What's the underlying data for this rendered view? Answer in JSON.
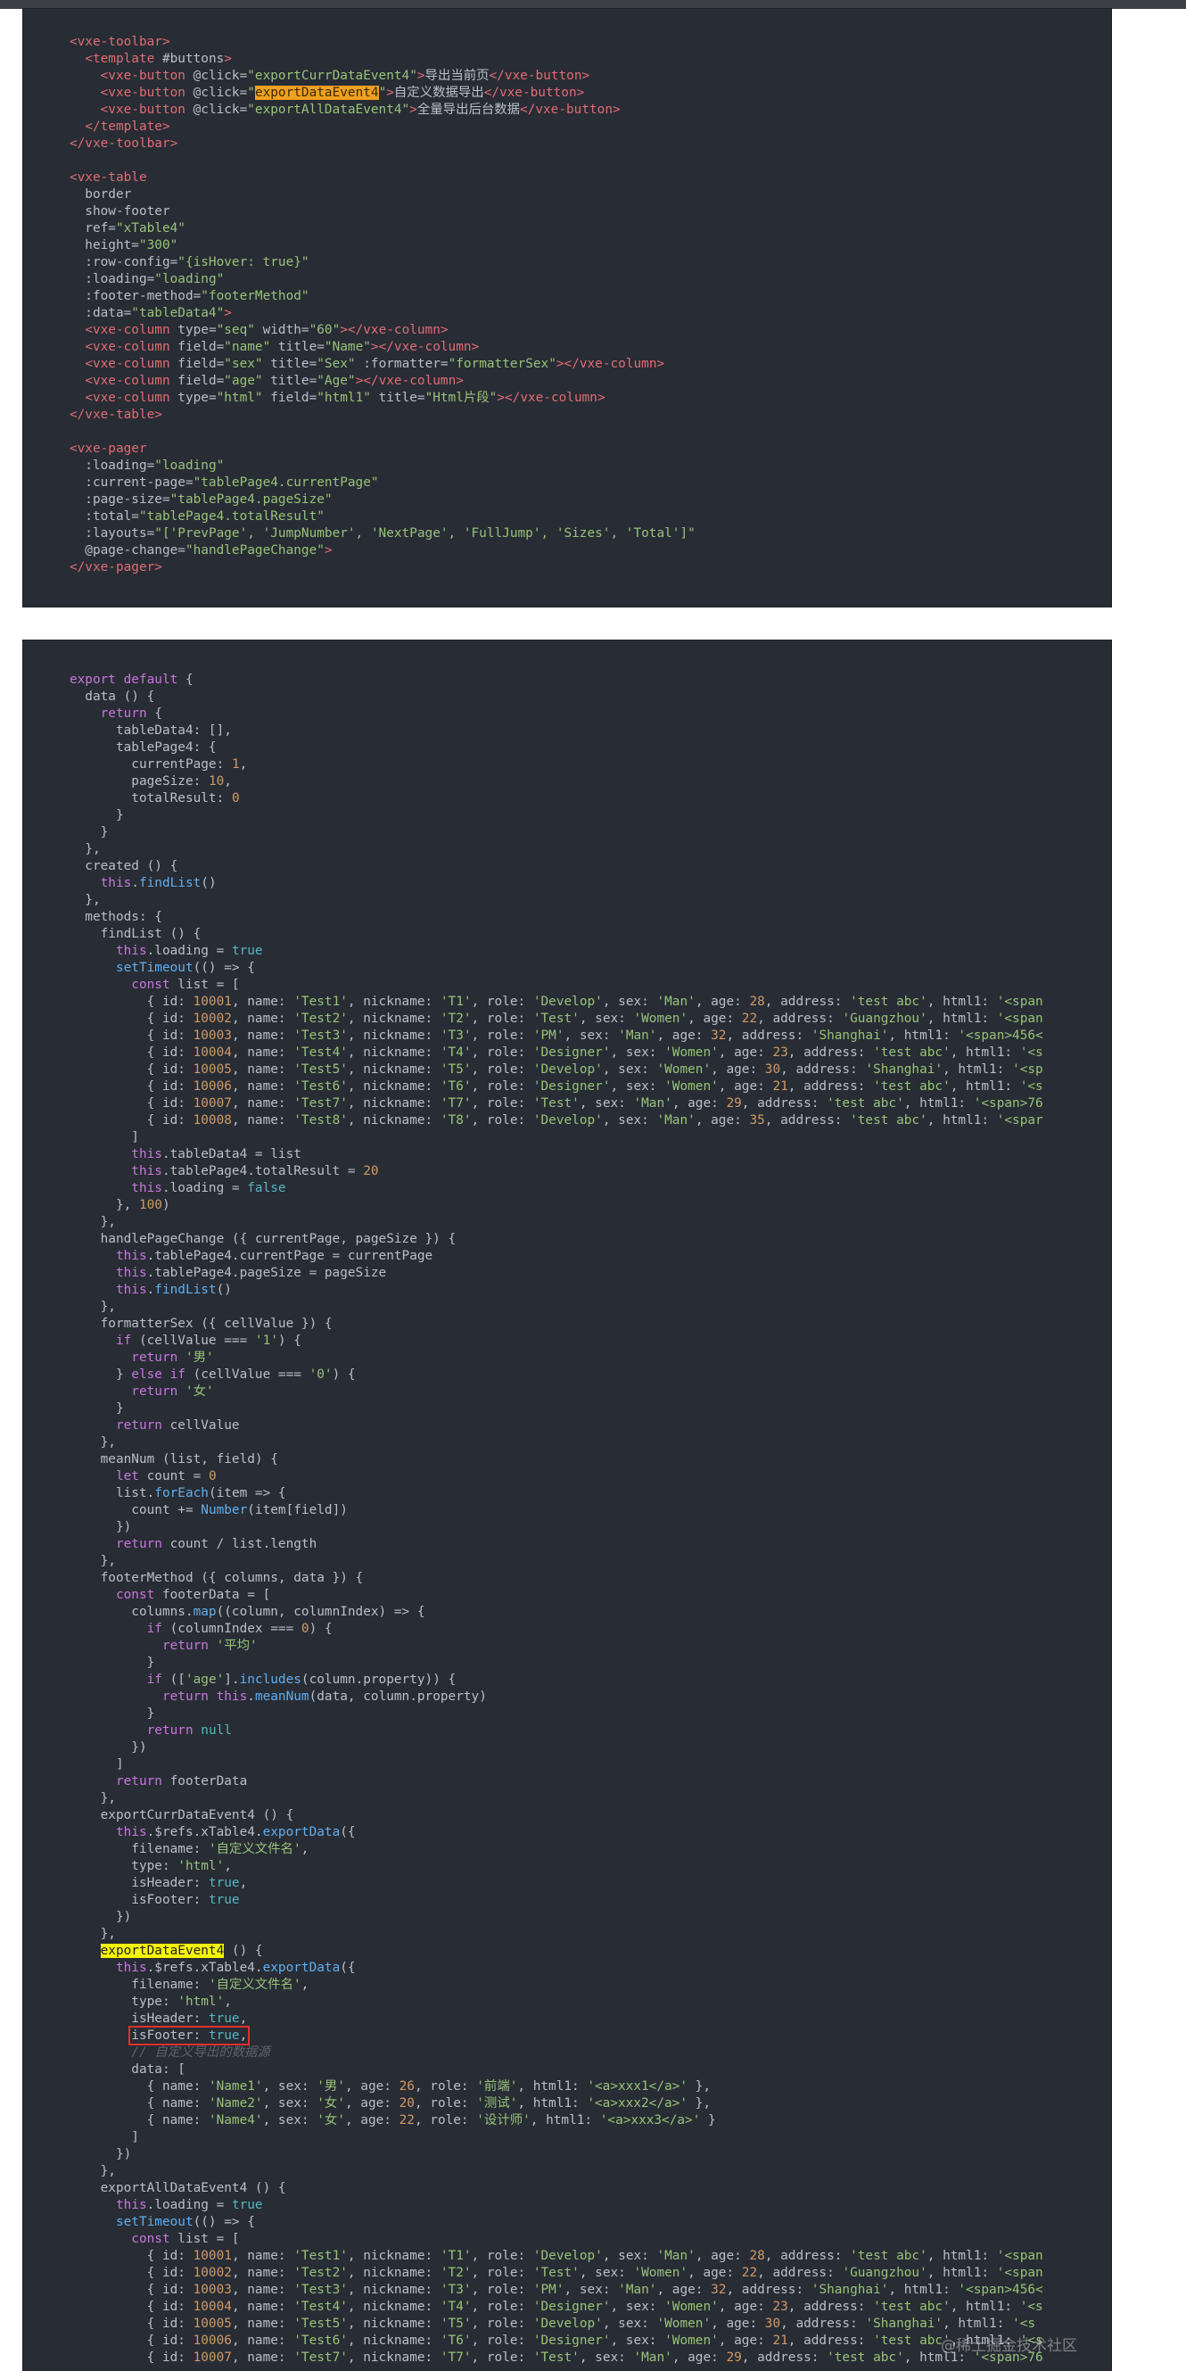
{
  "template_code": [
    "      <vxe-toolbar>",
    "        <template #buttons>",
    "          <vxe-button @click=\"exportCurrDataEvent4\">导出当前页</vxe-button>",
    "          <vxe-button @click=\"exportDataEvent4\">自定义数据导出</vxe-button>",
    "          <vxe-button @click=\"exportAllDataEvent4\">全量导出后台数据</vxe-button>",
    "        </template>",
    "      </vxe-toolbar>",
    "",
    "      <vxe-table",
    "        border",
    "        show-footer",
    "        ref=\"xTable4\"",
    "        height=\"300\"",
    "        :row-config=\"{isHover: true}\"",
    "        :loading=\"loading\"",
    "        :footer-method=\"footerMethod\"",
    "        :data=\"tableData4\">",
    "        <vxe-column type=\"seq\" width=\"60\"></vxe-column>",
    "        <vxe-column field=\"name\" title=\"Name\"></vxe-column>",
    "        <vxe-column field=\"sex\" title=\"Sex\" :formatter=\"formatterSex\"></vxe-column>",
    "        <vxe-column field=\"age\" title=\"Age\"></vxe-column>",
    "        <vxe-column type=\"html\" field=\"html1\" title=\"Html片段\"></vxe-column>",
    "      </vxe-table>",
    "",
    "      <vxe-pager",
    "        :loading=\"loading\"",
    "        :current-page=\"tablePage4.currentPage\"",
    "        :page-size=\"tablePage4.pageSize\"",
    "        :total=\"tablePage4.totalResult\"",
    "        :layouts=\"['PrevPage', 'JumpNumber', 'NextPage', 'FullJump', 'Sizes', 'Total']\"",
    "        @page-change=\"handlePageChange\">",
    "      </vxe-pager>"
  ],
  "script_code": [
    "      export default {",
    "        data () {",
    "          return {",
    "            tableData4: [],",
    "            tablePage4: {",
    "              currentPage: 1,",
    "              pageSize: 10,",
    "              totalResult: 0",
    "            }",
    "          }",
    "        },",
    "        created () {",
    "          this.findList()",
    "        },",
    "        methods: {",
    "          findList () {",
    "            this.loading = true",
    "            setTimeout(() => {",
    "              const list = [",
    "                { id: 10001, name: 'Test1', nickname: 'T1', role: 'Develop', sex: 'Man', age: 28, address: 'test abc', html1: '<span",
    "                { id: 10002, name: 'Test2', nickname: 'T2', role: 'Test', sex: 'Women', age: 22, address: 'Guangzhou', html1: '<span",
    "                { id: 10003, name: 'Test3', nickname: 'T3', role: 'PM', sex: 'Man', age: 32, address: 'Shanghai', html1: '<span>456<",
    "                { id: 10004, name: 'Test4', nickname: 'T4', role: 'Designer', sex: 'Women', age: 23, address: 'test abc', html1: '<s",
    "                { id: 10005, name: 'Test5', nickname: 'T5', role: 'Develop', sex: 'Women', age: 30, address: 'Shanghai', html1: '<sp",
    "                { id: 10006, name: 'Test6', nickname: 'T6', role: 'Designer', sex: 'Women', age: 21, address: 'test abc', html1: '<s",
    "                { id: 10007, name: 'Test7', nickname: 'T7', role: 'Test', sex: 'Man', age: 29, address: 'test abc', html1: '<span>76",
    "                { id: 10008, name: 'Test8', nickname: 'T8', role: 'Develop', sex: 'Man', age: 35, address: 'test abc', html1: '<spar",
    "              ]",
    "              this.tableData4 = list",
    "              this.tablePage4.totalResult = 20",
    "              this.loading = false",
    "            }, 100)",
    "          },",
    "          handlePageChange ({ currentPage, pageSize }) {",
    "            this.tablePage4.currentPage = currentPage",
    "            this.tablePage4.pageSize = pageSize",
    "            this.findList()",
    "          },",
    "          formatterSex ({ cellValue }) {",
    "            if (cellValue === '1') {",
    "              return '男'",
    "            } else if (cellValue === '0') {",
    "              return '女'",
    "            }",
    "            return cellValue",
    "          },",
    "          meanNum (list, field) {",
    "            let count = 0",
    "            list.forEach(item => {",
    "              count += Number(item[field])",
    "            })",
    "            return count / list.length",
    "          },",
    "          footerMethod ({ columns, data }) {",
    "            const footerData = [",
    "              columns.map((column, columnIndex) => {",
    "                if (columnIndex === 0) {",
    "                  return '平均'",
    "                }",
    "                if (['age'].includes(column.property)) {",
    "                  return this.meanNum(data, column.property)",
    "                }",
    "                return null",
    "              })",
    "            ]",
    "            return footerData",
    "          },",
    "          exportCurrDataEvent4 () {",
    "            this.$refs.xTable4.exportData({",
    "              filename: '自定义文件名',",
    "              type: 'html',",
    "              isHeader: true,",
    "              isFooter: true",
    "            })",
    "          },",
    "          exportDataEvent4 () {",
    "            this.$refs.xTable4.exportData({",
    "              filename: '自定义文件名',",
    "              type: 'html',",
    "              isHeader: true,",
    "              isFooter: true,",
    "              // 自定义导出的数据源",
    "              data: [",
    "                { name: 'Name1', sex: '男', age: 26, role: '前端', html1: '<a>xxx1</a>' },",
    "                { name: 'Name2', sex: '女', age: 20, role: '测试', html1: '<a>xxx2</a>' },",
    "                { name: 'Name4', sex: '女', age: 22, role: '设计师', html1: '<a>xxx3</a>' }",
    "              ]",
    "            })",
    "          },",
    "          exportAllDataEvent4 () {",
    "            this.loading = true",
    "            setTimeout(() => {",
    "              const list = [",
    "                { id: 10001, name: 'Test1', nickname: 'T1', role: 'Develop', sex: 'Man', age: 28, address: 'test abc', html1: '<span",
    "                { id: 10002, name: 'Test2', nickname: 'T2', role: 'Test', sex: 'Women', age: 22, address: 'Guangzhou', html1: '<span",
    "                { id: 10003, name: 'Test3', nickname: 'T3', role: 'PM', sex: 'Man', age: 32, address: 'Shanghai', html1: '<span>456<",
    "                { id: 10004, name: 'Test4', nickname: 'T4', role: 'Designer', sex: 'Women', age: 23, address: 'test abc', html1: '<s",
    "                { id: 10005, name: 'Test5', nickname: 'T5', role: 'Develop', sex: 'Women', age: 30, address: 'Shanghai', html1: '<s",
    "                { id: 10006, name: 'Test6', nickname: 'T6', role: 'Designer', sex: 'Women', age: 21, address: 'test abc', html1: '<s",
    "                { id: 10007, name: 'Test7', nickname: 'T7', role: 'Test', sex: 'Man', age: 29, address: 'test abc', html1: '<span>76"
  ],
  "highlight_search_term": "exportDataEvent4",
  "highlight_active_line": 75,
  "highlight_active_term": "exportDataEvent4",
  "red_box_line": 80,
  "red_box_term": "isFooter: true,",
  "watermark": "@稀土掘金技术社区",
  "colors": {
    "panel_bg": "#282c34",
    "search_highlight": "#f0a020",
    "active_highlight": "#f5f500",
    "red_box": "#e03030"
  }
}
